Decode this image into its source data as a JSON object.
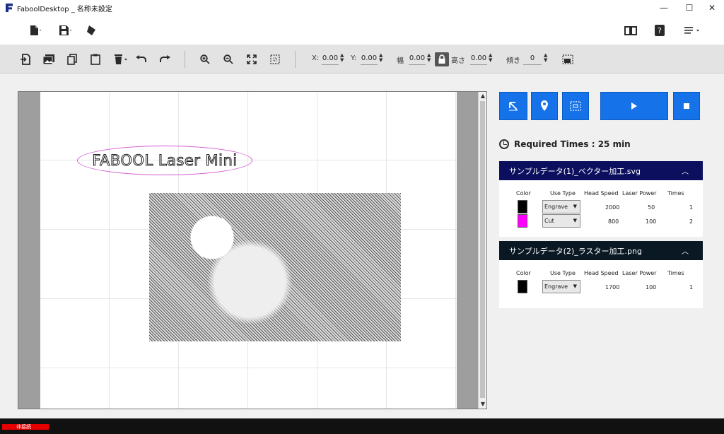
{
  "window": {
    "title": "FaboolDesktop _ 名称未設定",
    "minimize": "—",
    "maximize": "☐",
    "close": "✕"
  },
  "menubar": {
    "file_icon": "file-icon",
    "save_icon": "save-icon",
    "eraser_icon": "eraser-icon",
    "book_icon": "book-icon",
    "help_icon": "help-icon",
    "menu_icon": "menu-lines-icon"
  },
  "toolbar": {
    "x_label": "X:",
    "x_value": "0.00",
    "y_label": "Y:",
    "y_value": "0.00",
    "w_label": "幅",
    "w_value": "0.00",
    "h_label": "高さ",
    "h_value": "0.00",
    "rot_label": "傾き",
    "rot_value": "0"
  },
  "canvas": {
    "text_object": "FABOOL Laser Mini"
  },
  "panel": {
    "required_times": "Required Times :  25 min",
    "columns": {
      "color": "Color",
      "use_type": "Use Type",
      "head_speed": "Head Speed",
      "laser_power": "Laser Power",
      "times": "Times"
    },
    "groups": [
      {
        "name": "サンプルデータ(1)_ベクター加工.svg",
        "header_color": "#0b0f5e",
        "rows": [
          {
            "color": "#000000",
            "use_type": "Engrave",
            "head_speed": "2000",
            "laser_power": "50",
            "times": "1"
          },
          {
            "color": "#ff00ff",
            "use_type": "Cut",
            "head_speed": "800",
            "laser_power": "100",
            "times": "2"
          }
        ]
      },
      {
        "name": "サンプルデータ(2)_ラスター加工.png",
        "header_color": "#0a1824",
        "rows": [
          {
            "color": "#000000",
            "use_type": "Engrave",
            "head_speed": "1700",
            "laser_power": "100",
            "times": "1"
          }
        ]
      }
    ]
  },
  "status": {
    "text": "非接続"
  }
}
